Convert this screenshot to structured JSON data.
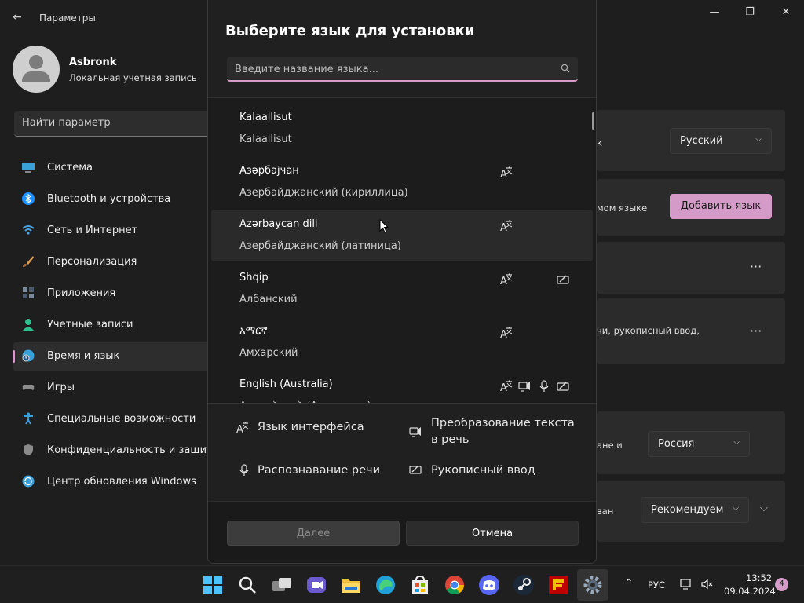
{
  "window": {
    "title": "Параметры",
    "back_icon": "arrow-left-icon",
    "minimize": "—",
    "maximize": "❐",
    "close": "✕"
  },
  "user": {
    "name": "Asbronk",
    "account_type": "Локальная учетная запись"
  },
  "search": {
    "placeholder": "Найти параметр"
  },
  "nav": [
    {
      "label": "Система",
      "icon": "system-icon",
      "color": "#3aa0d8"
    },
    {
      "label": "Bluetooth и устройства",
      "icon": "bluetooth-icon",
      "color": "#1e90ff"
    },
    {
      "label": "Сеть и Интернет",
      "icon": "wifi-icon",
      "color": "#4aa3df"
    },
    {
      "label": "Персонализация",
      "icon": "brush-icon",
      "color": "#e0a050"
    },
    {
      "label": "Приложения",
      "icon": "apps-icon",
      "color": "#7a8a9a"
    },
    {
      "label": "Учетные записи",
      "icon": "accounts-icon",
      "color": "#2fbf8f"
    },
    {
      "label": "Время и язык",
      "icon": "time-language-icon",
      "color": "#3aa0d8",
      "active": true
    },
    {
      "label": "Игры",
      "icon": "gaming-icon",
      "color": "#8a8a8a"
    },
    {
      "label": "Специальные возможности",
      "icon": "accessibility-icon",
      "color": "#3aa0d8"
    },
    {
      "label": "Конфиденциальность и защита",
      "icon": "shield-icon",
      "color": "#8a8a8a"
    },
    {
      "label": "Центр обновления Windows",
      "icon": "update-icon",
      "color": "#3aa0d8"
    }
  ],
  "background": {
    "c1_text": "к",
    "c1_select": "Русский",
    "c2_text": "мом языке",
    "add_language": "Добавить язык",
    "c4_text": "чи, рукописный ввод,",
    "c5_text_a": "ане и",
    "c5_select": "Россия",
    "c6_text": "ван",
    "c6_select": "Рекомендуем",
    "more": "···"
  },
  "dialog": {
    "title": "Выберите язык для установки",
    "search_placeholder": "Введите название языка...",
    "languages": [
      {
        "native": "Kalaallisut",
        "name": "Kalaallisut",
        "features": []
      },
      {
        "native": "Азәрбајҹан",
        "name": "Азербайджанский (кириллица)",
        "features": [
          "display-language"
        ]
      },
      {
        "native": "Azərbaycan dili",
        "name": "Азербайджанский (латиница)",
        "features": [
          "display-language"
        ],
        "hover": true
      },
      {
        "native": "Shqip",
        "name": "Албанский",
        "features": [
          "display-language",
          "handwriting"
        ]
      },
      {
        "native": "አማርኛ",
        "name": "Амхарский",
        "features": [
          "display-language"
        ]
      },
      {
        "native": "English (Australia)",
        "name": "Английский (Австралия)",
        "features": [
          "display-language",
          "text-to-speech",
          "speech-recognition",
          "handwriting"
        ]
      }
    ],
    "legend": {
      "display_language": "Язык интерфейса",
      "tts": "Преобразование текста в речь",
      "speech": "Распознавание речи",
      "handwriting": "Рукописный ввод"
    },
    "next": "Далее",
    "cancel": "Отмена"
  },
  "taskbar": {
    "apps": [
      "windows-start-icon",
      "search-icon",
      "task-view-icon",
      "meet-icon",
      "file-explorer-icon",
      "edge-icon",
      "store-icon",
      "chrome-icon",
      "discord-icon",
      "steam-icon",
      "filezilla-icon",
      "settings-icon"
    ],
    "input_language": "РУС",
    "time": "13:52",
    "date": "09.04.2024",
    "notifications": "4"
  },
  "colors": {
    "accent": "#d59bc8",
    "bg": "#1e1e1e",
    "card": "#2b2b2b"
  }
}
